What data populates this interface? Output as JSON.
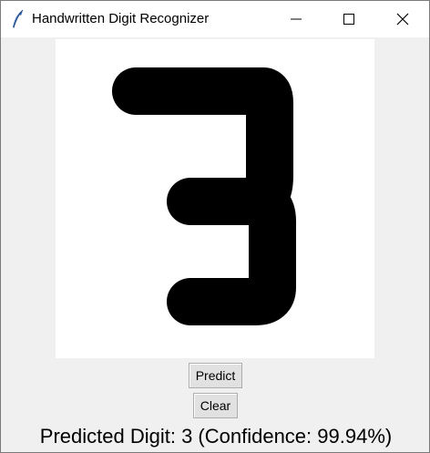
{
  "window": {
    "title": "Handwritten Digit Recognizer",
    "icon": "feather-icon"
  },
  "titlebar_controls": {
    "minimize_icon": "minimize-icon",
    "maximize_icon": "maximize-icon",
    "close_icon": "close-icon"
  },
  "canvas": {
    "drawn_digit": "3",
    "background_color": "#ffffff",
    "stroke_color": "#000000"
  },
  "buttons": {
    "predict_label": "Predict",
    "clear_label": "Clear"
  },
  "result": {
    "text": "Predicted Digit: 3 (Confidence: 99.94%)"
  }
}
